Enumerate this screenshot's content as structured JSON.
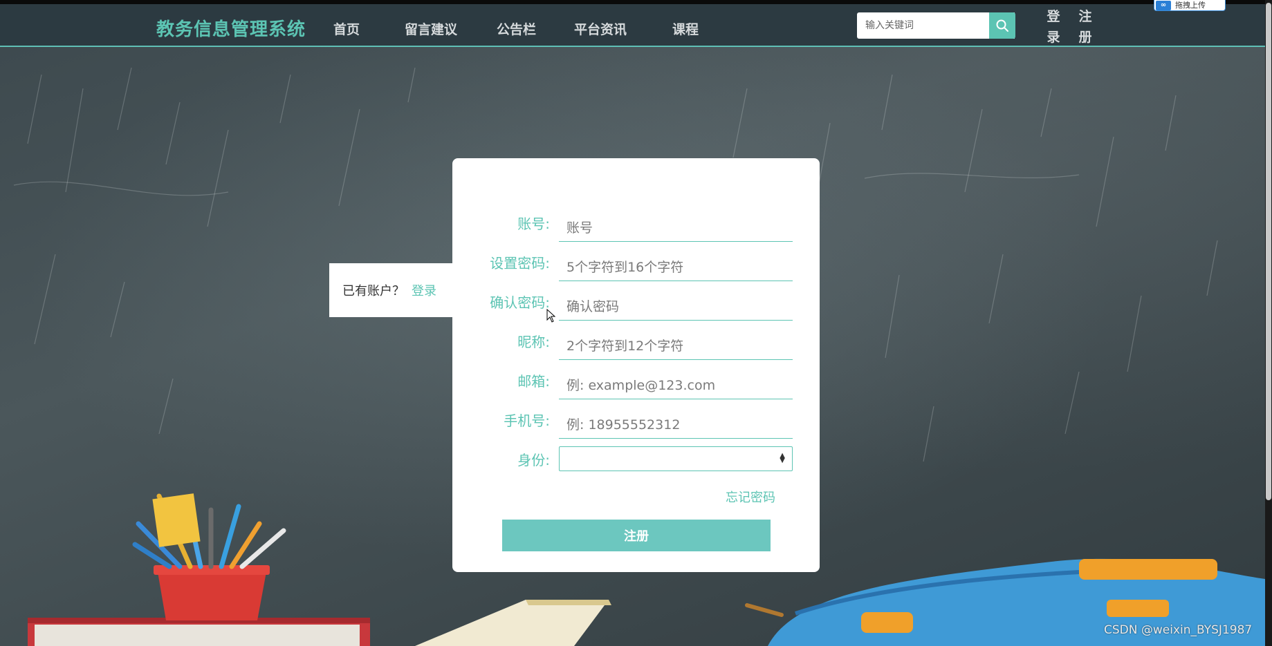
{
  "brand": {
    "title": "教务信息管理系统"
  },
  "nav": {
    "items": [
      {
        "label": "首页"
      },
      {
        "label": "留言建议"
      },
      {
        "label": "公告栏"
      },
      {
        "label": "平台资讯"
      },
      {
        "label": "课程"
      }
    ]
  },
  "search": {
    "placeholder": "输入关键词",
    "icon": "search-icon"
  },
  "auth": {
    "login": "登录",
    "register": "注册"
  },
  "login_tab": {
    "prompt": "已有账户？",
    "link": "登录"
  },
  "form": {
    "fields": [
      {
        "label": "账号:",
        "placeholder": "账号"
      },
      {
        "label": "设置密码:",
        "placeholder": "5个字符到16个字符"
      },
      {
        "label": "确认密码:",
        "placeholder": "确认密码"
      },
      {
        "label": "昵称:",
        "placeholder": "2个字符到12个字符"
      },
      {
        "label": "邮箱:",
        "placeholder": "例: example@123.com"
      },
      {
        "label": "手机号:",
        "placeholder": "例: 18955552312"
      }
    ],
    "role_label": "身份:",
    "role_value": "",
    "forgot": "忘记密码",
    "submit": "注册"
  },
  "watermark": "CSDN @weixin_BYSJ1987",
  "colors": {
    "accent": "#5cc4b3",
    "navbar": "#2c3a41",
    "button": "#6cc7bf"
  }
}
